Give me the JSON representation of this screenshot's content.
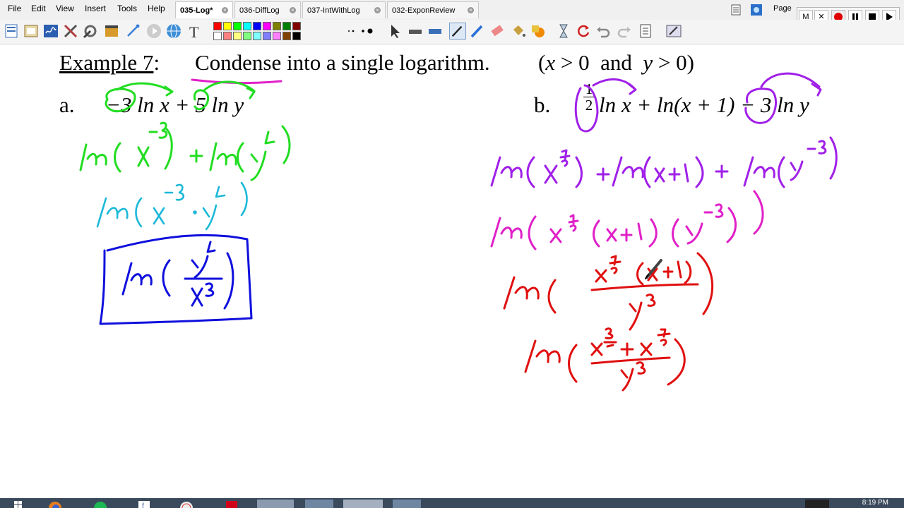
{
  "menu": [
    "File",
    "Edit",
    "View",
    "Insert",
    "Tools",
    "Help"
  ],
  "tabs": [
    {
      "label": "035-Log*",
      "active": true
    },
    {
      "label": "036-DiffLog",
      "active": false
    },
    {
      "label": "037-IntWithLog",
      "active": false
    },
    {
      "label": "032-ExponReview",
      "active": false
    }
  ],
  "page_label": "Page",
  "recorder": {
    "m_label": "M",
    "close_label": "✕"
  },
  "palette": [
    "#ff0000",
    "#ffff00",
    "#00ff00",
    "#00ffff",
    "#0000ff",
    "#ff00ff",
    "#808000",
    "#008000",
    "#800000",
    "#ffffff",
    "#ff8080",
    "#ffff80",
    "#80ff80",
    "#80ffff",
    "#8080ff",
    "#ff80ff",
    "#804000",
    "#000000"
  ],
  "example": {
    "heading_prefix": "Example 7",
    "heading_colon": ":",
    "instruction_verb": "Condense",
    "instruction_rest": "into a single logarithm.",
    "condition_open": "(",
    "condition_x": "x",
    "condition_gt1": " > 0  and  ",
    "condition_y": "y",
    "condition_gt2": " > 0)",
    "part_a_label": "a.",
    "part_a_expr": "−3 ln x + 5 ln y",
    "part_b_label": "b.",
    "part_b_frac_num": "1",
    "part_b_frac_den": "2",
    "part_b_expr": "ln x + ln(x + 1) − 3 ln y"
  },
  "ink_colors": {
    "green": "#22dd22",
    "cyan": "#1cb8d8",
    "blue": "#1010dd",
    "purple": "#a020e8",
    "magenta": "#e020c8",
    "red": "#e01010",
    "underline": "#e020c8"
  },
  "clock": "8:19 PM"
}
